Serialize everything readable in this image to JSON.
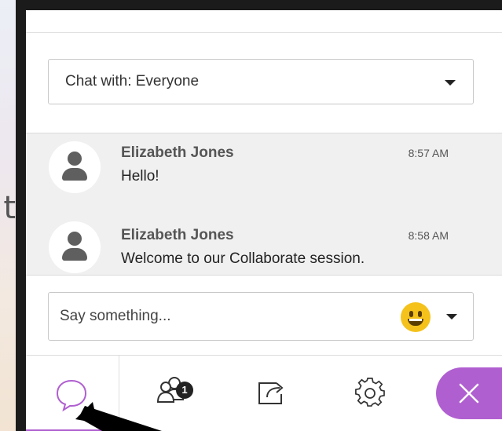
{
  "chat_select": {
    "label": "Chat with: Everyone"
  },
  "messages": [
    {
      "name": "Elizabeth Jones",
      "time": "8:57 AM",
      "text": "Hello!"
    },
    {
      "name": "Elizabeth Jones",
      "time": "8:58 AM",
      "text": "Welcome to our Collaborate session."
    }
  ],
  "composer": {
    "placeholder": "Say something..."
  },
  "tabs": [
    {
      "icon": "chat-bubble-icon",
      "active": true
    },
    {
      "icon": "attendees-icon",
      "badge": "1"
    },
    {
      "icon": "share-content-icon"
    },
    {
      "icon": "settings-gear-icon"
    }
  ],
  "close_button": {
    "icon": "close-x-icon"
  },
  "colors": {
    "accent": "#b05fd0",
    "emoji": "#f4c21b",
    "panel_border": "#1b1b1b"
  }
}
